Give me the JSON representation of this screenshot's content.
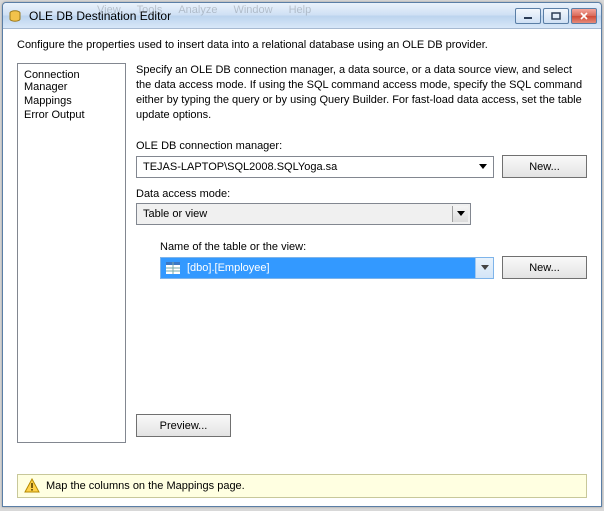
{
  "window": {
    "title": "OLE DB Destination Editor",
    "menu_ghost": [
      "View",
      "Tools",
      "Analyze",
      "Window",
      "Help"
    ]
  },
  "header": {
    "description": "Configure the properties used to insert data into a relational database using an OLE DB provider."
  },
  "sidebar": {
    "items": [
      {
        "label": "Connection Manager"
      },
      {
        "label": "Mappings"
      },
      {
        "label": "Error Output"
      }
    ]
  },
  "main": {
    "instruction": "Specify an OLE DB connection manager, a data source, or a data source view, and select the data access mode. If using the SQL command access mode, specify the SQL command either by typing the query or by using Query Builder. For fast-load data access, set the table update options.",
    "conn_label": "OLE DB connection manager:",
    "conn_value": "TEJAS-LAPTOP\\SQL2008.SQLYoga.sa",
    "new1_label": "New...",
    "mode_label": "Data access mode:",
    "mode_value": "Table or view",
    "table_label": "Name of the table or the view:",
    "table_value": "[dbo].[Employee]",
    "new2_label": "New...",
    "preview_label": "Preview..."
  },
  "footer": {
    "warning": "Map the columns on the Mappings page."
  }
}
